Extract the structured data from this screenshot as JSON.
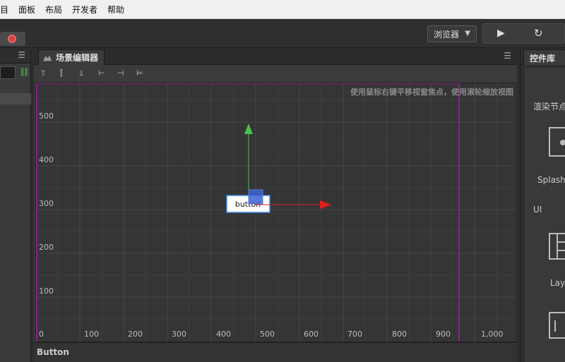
{
  "menu": {
    "items": [
      "目",
      "面板",
      "布局",
      "开发者",
      "帮助"
    ]
  },
  "toolbar": {
    "browser_label": "浏览器",
    "play_icon": "▶",
    "refresh_icon": "↻"
  },
  "scene_editor": {
    "tab_label": "场景编辑器",
    "hint": "使用鼠标右键平移视窗焦点，使用滚轮缩放视图",
    "y_ticks": [
      "500",
      "400",
      "300",
      "200",
      "100"
    ],
    "x_ticks": [
      "0",
      "100",
      "200",
      "300",
      "400",
      "500",
      "600",
      "700",
      "800",
      "900",
      "1,000"
    ],
    "node_label": "button",
    "status_label": "Button"
  },
  "right_panel": {
    "title": "控件库",
    "section_render": "渲染节点",
    "item_splash": "Splash",
    "section_ui": "UI",
    "item_layout": "Layo"
  },
  "colors": {
    "axis_x": "#e02020",
    "axis_y": "#4cc04c",
    "canvas_border": "#a020a0"
  }
}
